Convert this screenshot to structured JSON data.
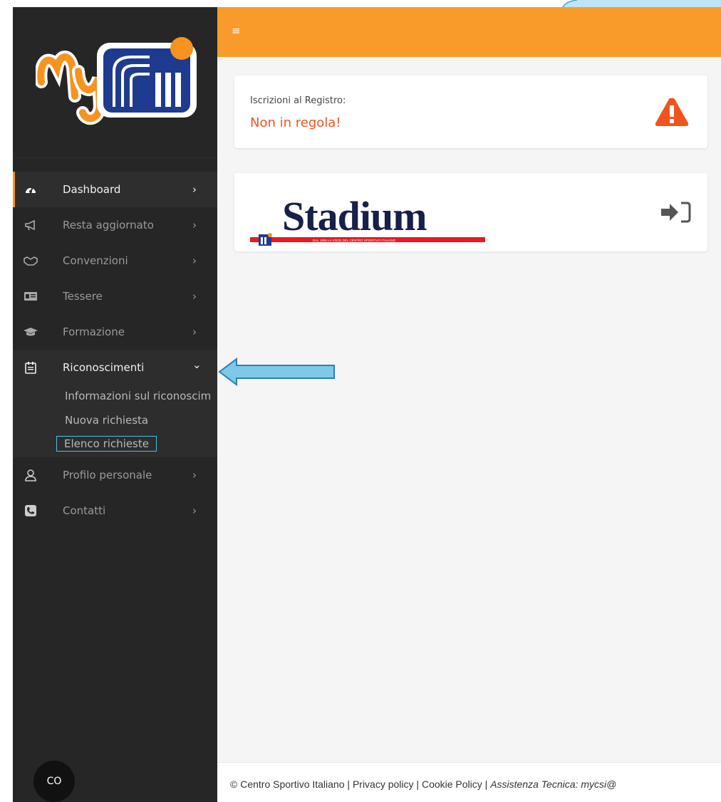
{
  "sidebar": {
    "items": [
      {
        "label": "Dashboard",
        "icon": "gauge-icon"
      },
      {
        "label": "Resta aggiornato",
        "icon": "megaphone-icon"
      },
      {
        "label": "Convenzioni",
        "icon": "handshake-icon"
      },
      {
        "label": "Tessere",
        "icon": "id-card-icon"
      },
      {
        "label": "Formazione",
        "icon": "graduation-cap-icon"
      },
      {
        "label": "Riconoscimenti",
        "icon": "calendar-icon"
      },
      {
        "label": "Profilo personale",
        "icon": "user-icon"
      },
      {
        "label": "Contatti",
        "icon": "phone-icon"
      }
    ],
    "submenu": {
      "info": "Informazioni sul riconoscim",
      "new": "Nuova richiesta",
      "list": "Elenco richieste"
    },
    "fab_label": "CO",
    "chevron_right": "›",
    "chevron_down": "⌄"
  },
  "topbar": {
    "menu_symbol": "≡"
  },
  "registry_card": {
    "label": "Iscrizioni al Registro:",
    "status": "Non in regola!"
  },
  "stadium_card": {
    "brand": "Stadium",
    "tagline": "DAL 1906 LA VOCE DEL CENTRO SPORTIVO ITALIANO"
  },
  "footer": {
    "copyright": "© Centro Sportivo Italiano",
    "sep": " | ",
    "privacy": "Privacy policy",
    "cookie": "Cookie Policy",
    "assist_label": "Assistenza Tecnica:",
    "assist_email": "mycsi@"
  },
  "colors": {
    "accent": "#f89b2b",
    "warning": "#f0541e",
    "sidebar": "#262626",
    "highlight": "#4cc0e8"
  }
}
